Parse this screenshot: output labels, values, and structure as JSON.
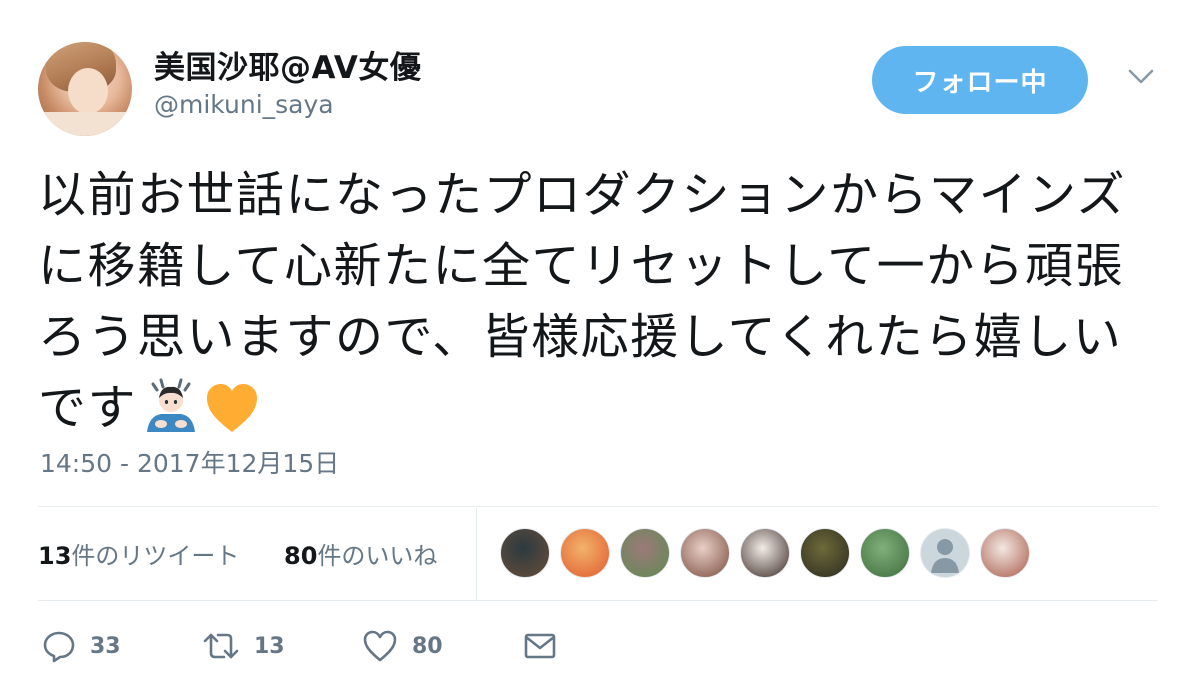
{
  "user": {
    "display_name": "美国沙耶@AV女優",
    "screen_name": "@mikuni_saya"
  },
  "follow_button": {
    "label": "フォロー中"
  },
  "tweet": {
    "text": "以前お世話になったプロダクションからマインズに移籍して心新たに全てリセットして一から頑張ろう思いますので、皆様応援してくれたら嬉しいです",
    "emojis": [
      "person-bowing-icon",
      "orange-heart-icon"
    ],
    "timestamp": "14:50 - 2017年12月15日"
  },
  "stats": {
    "retweets_count": "13",
    "retweets_suffix": "件のリツイート",
    "likes_count": "80",
    "likes_suffix": "件のいいね"
  },
  "likers": [
    {
      "name": "liker-avatar-1",
      "colors": [
        "#2b3a3f",
        "#6a4e3a"
      ]
    },
    {
      "name": "liker-avatar-2",
      "colors": [
        "#f2b36b",
        "#e05a2c"
      ]
    },
    {
      "name": "liker-avatar-3",
      "colors": [
        "#9c7a7a",
        "#5e8a52"
      ]
    },
    {
      "name": "liker-avatar-4",
      "colors": [
        "#e8cfc6",
        "#7a4b3e"
      ]
    },
    {
      "name": "liker-avatar-5",
      "colors": [
        "#f2ece6",
        "#3a2a25"
      ]
    },
    {
      "name": "liker-avatar-6",
      "colors": [
        "#6d6a3a",
        "#2c2a1e"
      ]
    },
    {
      "name": "liker-avatar-7",
      "colors": [
        "#7fb07a",
        "#3f6b3d"
      ]
    },
    {
      "name": "liker-avatar-8",
      "colors": [
        "#ccd6dd",
        "#8899a6"
      ]
    },
    {
      "name": "liker-avatar-9",
      "colors": [
        "#f2e8e2",
        "#a85a4a"
      ]
    }
  ],
  "actions": {
    "reply_count": "33",
    "retweet_count": "13",
    "like_count": "80"
  },
  "colors": {
    "accent": "#5eb5f0",
    "secondary_text": "#657786",
    "divider": "#e6ecf0",
    "heart_orange": "#ffac33"
  }
}
